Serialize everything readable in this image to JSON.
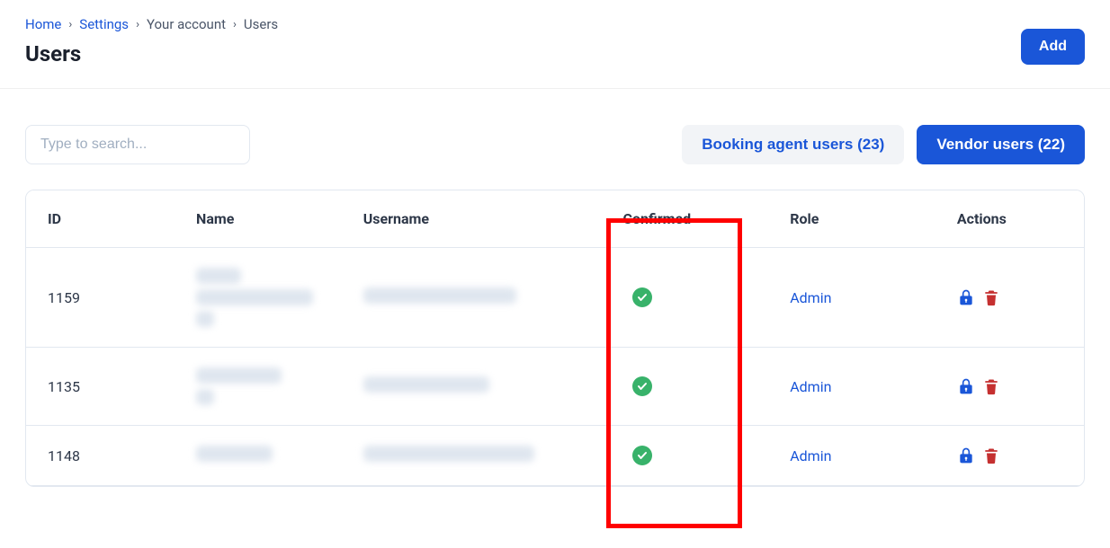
{
  "breadcrumb": {
    "home": "Home",
    "settings": "Settings",
    "your_account": "Your account",
    "users": "Users"
  },
  "page": {
    "title": "Users"
  },
  "header": {
    "add_label": "Add"
  },
  "search": {
    "placeholder": "Type to search..."
  },
  "tabs": {
    "booking_label": "Booking agent users (23)",
    "vendor_label": "Vendor users (22)"
  },
  "table": {
    "headers": {
      "id": "ID",
      "name": "Name",
      "username": "Username",
      "confirmed": "Confirmed",
      "role": "Role",
      "actions": "Actions"
    },
    "rows": [
      {
        "id": "1159",
        "role": "Admin"
      },
      {
        "id": "1135",
        "role": "Admin"
      },
      {
        "id": "1148",
        "role": "Admin"
      }
    ]
  },
  "icons": {
    "check": "check-icon",
    "lock": "lock-icon",
    "trash": "trash-icon"
  }
}
